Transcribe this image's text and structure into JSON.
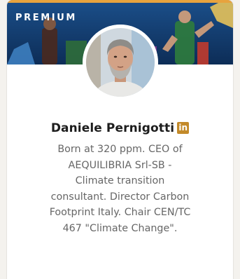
{
  "card": {
    "banner_label": "PREMIUM",
    "name": "Daniele Pernigotti",
    "badge_text": "in",
    "badge_icon": "linkedin-premium-icon",
    "headline_lines": [
      "Born at 320 ppm. CEO of",
      "AEQUILIBRIA Srl-SB -",
      "Climate transition",
      "consultant. Director Carbon",
      "Footprint Italy. Chair CEN/TC",
      "467 \"Climate Change\"."
    ]
  },
  "colors": {
    "premium_gold": "#e7a33e",
    "badge_gold": "#c38a2a",
    "banner_navy": "#123a6b",
    "name_text": "#1d1d1d",
    "headline_text": "#666666"
  }
}
